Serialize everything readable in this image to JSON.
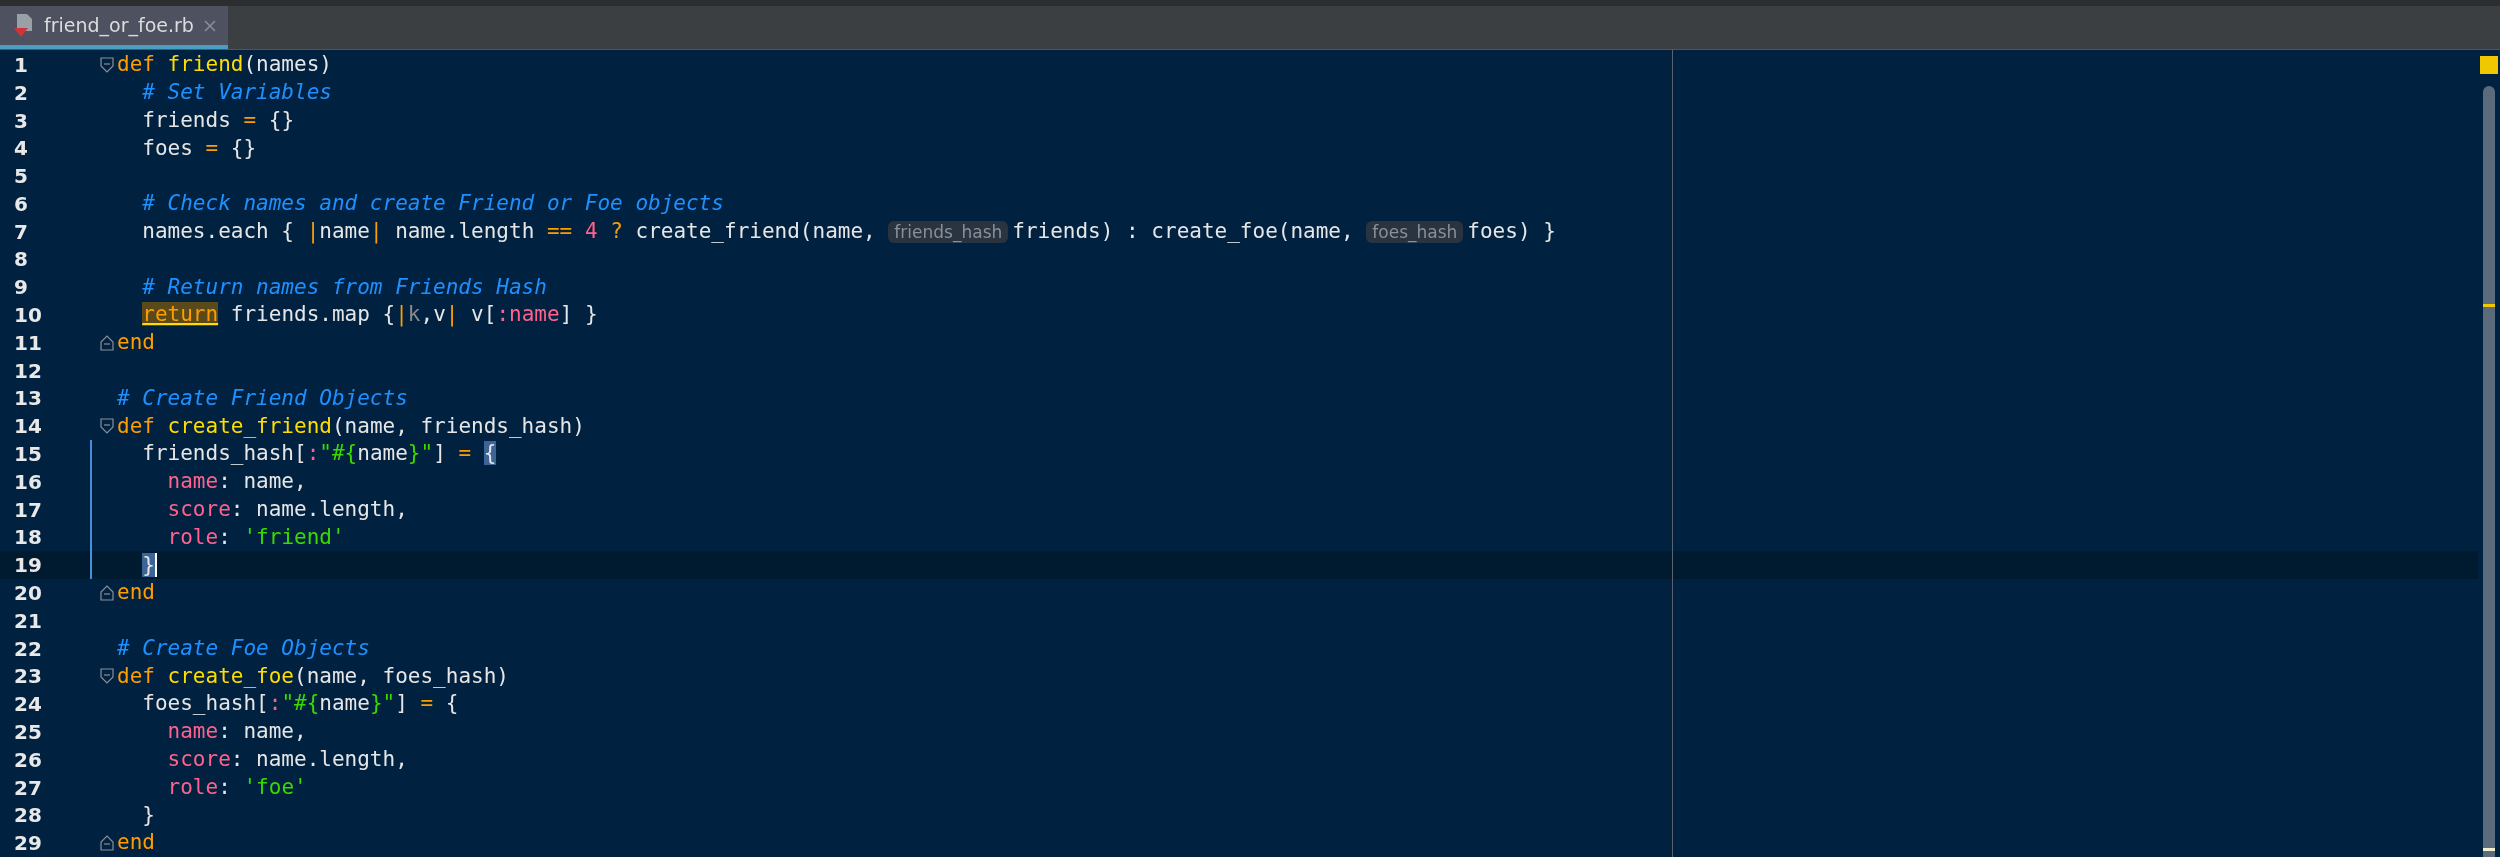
{
  "tabs": [
    {
      "label": "friend_or_foe.rb",
      "selected": true
    }
  ],
  "lines": [
    {
      "number": "1",
      "fold_start": true,
      "fold_end": false,
      "changed": false,
      "current": false,
      "caret": false,
      "tokens": [
        {
          "text": "def ",
          "kind": "keyword"
        },
        {
          "text": "friend",
          "kind": "function"
        },
        {
          "text": "(names)",
          "kind": "plain"
        }
      ]
    },
    {
      "number": "2",
      "fold_start": false,
      "fold_end": false,
      "changed": false,
      "current": false,
      "caret": false,
      "tokens": [
        {
          "text": "  # Set Variables",
          "kind": "comment"
        }
      ]
    },
    {
      "number": "3",
      "fold_start": false,
      "fold_end": false,
      "changed": false,
      "current": false,
      "caret": false,
      "tokens": [
        {
          "text": "  friends ",
          "kind": "plain"
        },
        {
          "text": "=",
          "kind": "operator"
        },
        {
          "text": " {}",
          "kind": "plain"
        }
      ]
    },
    {
      "number": "4",
      "fold_start": false,
      "fold_end": false,
      "changed": false,
      "current": false,
      "caret": false,
      "tokens": [
        {
          "text": "  foes ",
          "kind": "plain"
        },
        {
          "text": "=",
          "kind": "operator"
        },
        {
          "text": " {}",
          "kind": "plain"
        }
      ]
    },
    {
      "number": "5",
      "fold_start": false,
      "fold_end": false,
      "changed": false,
      "current": false,
      "caret": false
    },
    {
      "number": "6",
      "fold_start": false,
      "fold_end": false,
      "changed": false,
      "current": false,
      "caret": false,
      "tokens": [
        {
          "text": "  # Check names and create Friend or Foe objects",
          "kind": "comment"
        }
      ]
    },
    {
      "number": "7",
      "fold_start": false,
      "fold_end": false,
      "changed": false,
      "current": false,
      "caret": false,
      "tokens": [
        {
          "text": "  names.each { ",
          "kind": "plain"
        },
        {
          "text": "|",
          "kind": "operator"
        },
        {
          "text": "name",
          "kind": "plain"
        },
        {
          "text": "|",
          "kind": "operator"
        },
        {
          "text": " name.length ",
          "kind": "plain"
        },
        {
          "text": "== ",
          "kind": "operator"
        },
        {
          "text": "4",
          "kind": "number"
        },
        {
          "text": " ? ",
          "kind": "operator"
        },
        {
          "text": "create_friend(name, ",
          "kind": "plain"
        },
        {
          "text": "friends_hash",
          "kind": "hint"
        },
        {
          "text": "friends) : create_foe(name, ",
          "kind": "plain"
        },
        {
          "text": "foes_hash",
          "kind": "hint"
        },
        {
          "text": "foes) }",
          "kind": "plain"
        }
      ]
    },
    {
      "number": "8",
      "fold_start": false,
      "fold_end": false,
      "changed": false,
      "current": false,
      "caret": false
    },
    {
      "number": "9",
      "fold_start": false,
      "fold_end": false,
      "changed": false,
      "current": false,
      "caret": false,
      "tokens": [
        {
          "text": "  # Return names from Friends Hash",
          "kind": "comment"
        }
      ]
    },
    {
      "number": "10",
      "fold_start": false,
      "fold_end": false,
      "changed": false,
      "current": false,
      "caret": false,
      "tokens": [
        {
          "text": "  return",
          "kind": "usage"
        },
        {
          "text": " friends.map {",
          "kind": "plain"
        },
        {
          "text": "|",
          "kind": "operator"
        },
        {
          "text": "k",
          "kind": "unused"
        },
        {
          "text": ",v",
          "kind": "plain"
        },
        {
          "text": "|",
          "kind": "operator"
        },
        {
          "text": " v[",
          "kind": "plain"
        },
        {
          "text": ":name",
          "kind": "symbol"
        },
        {
          "text": "] }",
          "kind": "plain"
        }
      ]
    },
    {
      "number": "11",
      "fold_start": false,
      "fold_end": true,
      "changed": false,
      "current": false,
      "caret": false,
      "tokens": [
        {
          "text": "end",
          "kind": "keyword"
        }
      ]
    },
    {
      "number": "12",
      "fold_start": false,
      "fold_end": false,
      "changed": false,
      "current": false,
      "caret": false
    },
    {
      "number": "13",
      "fold_start": false,
      "fold_end": false,
      "changed": false,
      "current": false,
      "caret": false,
      "tokens": [
        {
          "text": "# Create Friend Objects",
          "kind": "comment"
        }
      ]
    },
    {
      "number": "14",
      "fold_start": true,
      "fold_end": false,
      "changed": false,
      "current": false,
      "caret": false,
      "tokens": [
        {
          "text": "def ",
          "kind": "keyword"
        },
        {
          "text": "create_friend",
          "kind": "function"
        },
        {
          "text": "(name, friends_hash)",
          "kind": "plain"
        }
      ]
    },
    {
      "number": "15",
      "fold_start": false,
      "fold_end": false,
      "changed": true,
      "current": false,
      "caret": false,
      "tokens": [
        {
          "text": "  friends_hash[",
          "kind": "plain"
        },
        {
          "text": ":",
          "kind": "symbol"
        },
        {
          "text": "\"#{",
          "kind": "string"
        },
        {
          "text": "name",
          "kind": "plain"
        },
        {
          "text": "}\"",
          "kind": "string"
        },
        {
          "text": "] ",
          "kind": "plain"
        },
        {
          "text": "= ",
          "kind": "operator"
        },
        {
          "text": "{",
          "kind": "brace"
        }
      ]
    },
    {
      "number": "16",
      "fold_start": false,
      "fold_end": false,
      "changed": true,
      "current": false,
      "caret": false,
      "tokens": [
        {
          "text": "    name",
          "kind": "symbol"
        },
        {
          "text": ": name,",
          "kind": "plain"
        }
      ]
    },
    {
      "number": "17",
      "fold_start": false,
      "fold_end": false,
      "changed": true,
      "current": false,
      "caret": false,
      "tokens": [
        {
          "text": "    score",
          "kind": "symbol"
        },
        {
          "text": ": name.length,",
          "kind": "plain"
        }
      ]
    },
    {
      "number": "18",
      "fold_start": false,
      "fold_end": false,
      "changed": true,
      "current": false,
      "caret": false,
      "tokens": [
        {
          "text": "    role",
          "kind": "symbol"
        },
        {
          "text": ": ",
          "kind": "plain"
        },
        {
          "text": "'friend'",
          "kind": "string"
        }
      ]
    },
    {
      "number": "19",
      "fold_start": false,
      "fold_end": false,
      "changed": true,
      "current": true,
      "caret": true,
      "tokens": [
        {
          "text": "  }",
          "kind": "brace"
        }
      ]
    },
    {
      "number": "20",
      "fold_start": false,
      "fold_end": true,
      "changed": false,
      "current": false,
      "caret": false,
      "tokens": [
        {
          "text": "end",
          "kind": "keyword"
        }
      ]
    },
    {
      "number": "21",
      "fold_start": false,
      "fold_end": false,
      "changed": false,
      "current": false,
      "caret": false
    },
    {
      "number": "22",
      "fold_start": false,
      "fold_end": false,
      "changed": false,
      "current": false,
      "caret": false,
      "tokens": [
        {
          "text": "# Create Foe Objects",
          "kind": "comment"
        }
      ]
    },
    {
      "number": "23",
      "fold_start": true,
      "fold_end": false,
      "changed": false,
      "current": false,
      "caret": false,
      "tokens": [
        {
          "text": "def ",
          "kind": "keyword"
        },
        {
          "text": "create_foe",
          "kind": "function"
        },
        {
          "text": "(name, foes_hash)",
          "kind": "plain"
        }
      ]
    },
    {
      "number": "24",
      "fold_start": false,
      "fold_end": false,
      "changed": false,
      "current": false,
      "caret": false,
      "tokens": [
        {
          "text": "  foes_hash[",
          "kind": "plain"
        },
        {
          "text": ":",
          "kind": "symbol"
        },
        {
          "text": "\"#{",
          "kind": "string"
        },
        {
          "text": "name",
          "kind": "plain"
        },
        {
          "text": "}\"",
          "kind": "string"
        },
        {
          "text": "] ",
          "kind": "plain"
        },
        {
          "text": "=",
          "kind": "operator"
        },
        {
          "text": " {",
          "kind": "plain"
        }
      ]
    },
    {
      "number": "25",
      "fold_start": false,
      "fold_end": false,
      "changed": false,
      "current": false,
      "caret": false,
      "tokens": [
        {
          "text": "    name",
          "kind": "symbol"
        },
        {
          "text": ": name,",
          "kind": "plain"
        }
      ]
    },
    {
      "number": "26",
      "fold_start": false,
      "fold_end": false,
      "changed": false,
      "current": false,
      "caret": false,
      "tokens": [
        {
          "text": "    score",
          "kind": "symbol"
        },
        {
          "text": ": name.length,",
          "kind": "plain"
        }
      ]
    },
    {
      "number": "27",
      "fold_start": false,
      "fold_end": false,
      "changed": false,
      "current": false,
      "caret": false,
      "tokens": [
        {
          "text": "    role",
          "kind": "symbol"
        },
        {
          "text": ": ",
          "kind": "plain"
        },
        {
          "text": "'foe'",
          "kind": "string"
        }
      ]
    },
    {
      "number": "28",
      "fold_start": false,
      "fold_end": false,
      "changed": false,
      "current": false,
      "caret": false,
      "tokens": [
        {
          "text": "  }",
          "kind": "plain"
        }
      ]
    },
    {
      "number": "29",
      "fold_start": false,
      "fold_end": true,
      "changed": false,
      "current": false,
      "caret": false,
      "tokens": [
        {
          "text": "end",
          "kind": "keyword"
        }
      ]
    }
  ]
}
